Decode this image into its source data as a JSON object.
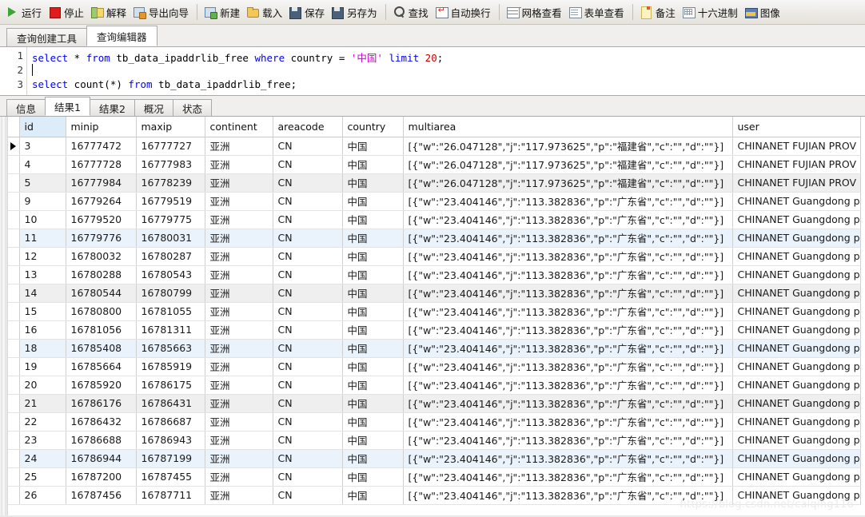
{
  "toolbar": {
    "groups": [
      {
        "items": [
          {
            "label": "运行",
            "icon": "run-icon",
            "icon_class": "ico-run"
          },
          {
            "label": "停止",
            "icon": "stop-icon",
            "icon_class": "ico-stop"
          },
          {
            "label": "解释",
            "icon": "explain-icon",
            "icon_class": "ico-explain"
          },
          {
            "label": "导出向导",
            "icon": "export-wizard-icon",
            "icon_class": "ico-export"
          }
        ]
      },
      {
        "items": [
          {
            "label": "新建",
            "icon": "new-icon",
            "icon_class": "ico-new"
          },
          {
            "label": "载入",
            "icon": "open-folder-icon",
            "icon_class": "ico-open"
          },
          {
            "label": "保存",
            "icon": "save-icon",
            "icon_class": "ico-save"
          },
          {
            "label": "另存为",
            "icon": "save-as-icon",
            "icon_class": "ico-saveas"
          }
        ]
      },
      {
        "items": [
          {
            "label": "查找",
            "icon": "search-icon",
            "icon_class": "ico-find"
          },
          {
            "label": "自动换行",
            "icon": "word-wrap-icon",
            "icon_class": "ico-wrap"
          }
        ]
      },
      {
        "items": [
          {
            "label": "网格查看",
            "icon": "grid-view-icon",
            "icon_class": "ico-grid"
          },
          {
            "label": "表单查看",
            "icon": "form-view-icon",
            "icon_class": "ico-form"
          }
        ]
      },
      {
        "items": [
          {
            "label": "备注",
            "icon": "note-icon",
            "icon_class": "ico-note"
          },
          {
            "label": "十六进制",
            "icon": "hex-icon",
            "icon_class": "ico-hex"
          },
          {
            "label": "图像",
            "icon": "image-icon",
            "icon_class": "ico-image"
          }
        ]
      }
    ]
  },
  "editor_tabs": [
    {
      "label": "查询创建工具",
      "active": false
    },
    {
      "label": "查询编辑器",
      "active": true
    }
  ],
  "editor": {
    "lines": [
      {
        "number": "1",
        "tokens": [
          {
            "text": "select",
            "type": "kw"
          },
          {
            "text": " * ",
            "type": "op"
          },
          {
            "text": "from",
            "type": "kw"
          },
          {
            "text": " tb_data_ipaddrlib_free ",
            "type": "op"
          },
          {
            "text": "where",
            "type": "kw"
          },
          {
            "text": " country = ",
            "type": "op"
          },
          {
            "text": "'中国'",
            "type": "str"
          },
          {
            "text": " ",
            "type": "op"
          },
          {
            "text": "limit",
            "type": "kw"
          },
          {
            "text": " ",
            "type": "op"
          },
          {
            "text": "20",
            "type": "num"
          },
          {
            "text": ";",
            "type": "op"
          }
        ]
      },
      {
        "number": "2",
        "tokens": []
      },
      {
        "number": "3",
        "tokens": [
          {
            "text": "select",
            "type": "kw"
          },
          {
            "text": " count(*) ",
            "type": "op"
          },
          {
            "text": "from",
            "type": "kw"
          },
          {
            "text": " tb_data_ipaddrlib_free;",
            "type": "op"
          }
        ]
      }
    ]
  },
  "result_tabs": [
    {
      "label": "信息",
      "active": false
    },
    {
      "label": "结果1",
      "active": true
    },
    {
      "label": "结果2",
      "active": false
    },
    {
      "label": "概况",
      "active": false
    },
    {
      "label": "状态",
      "active": false
    }
  ],
  "grid": {
    "columns": [
      {
        "key": "id",
        "label": "id",
        "selected": true,
        "align": "right"
      },
      {
        "key": "minip",
        "label": "minip",
        "selected": false,
        "align": "right"
      },
      {
        "key": "maxip",
        "label": "maxip",
        "selected": false,
        "align": "right"
      },
      {
        "key": "continent",
        "label": "continent",
        "selected": false,
        "align": "left"
      },
      {
        "key": "areacode",
        "label": "areacode",
        "selected": false,
        "align": "left"
      },
      {
        "key": "country",
        "label": "country",
        "selected": false,
        "align": "left"
      },
      {
        "key": "multiarea",
        "label": "multiarea",
        "selected": false,
        "align": "left"
      },
      {
        "key": "user",
        "label": "user",
        "selected": false,
        "align": "left"
      }
    ],
    "current_row_index": 0,
    "rows": [
      {
        "id": "3",
        "minip": "16777472",
        "maxip": "16777727",
        "continent": "亚洲",
        "areacode": "CN",
        "country": "中国",
        "multiarea": "[{\"w\":\"26.047128\",\"j\":\"117.973625\",\"p\":\"福建省\",\"c\":\"\",\"d\":\"\"}]",
        "user": "CHINANET FUJIAN PROV",
        "stripe": "none"
      },
      {
        "id": "4",
        "minip": "16777728",
        "maxip": "16777983",
        "continent": "亚洲",
        "areacode": "CN",
        "country": "中国",
        "multiarea": "[{\"w\":\"26.047128\",\"j\":\"117.973625\",\"p\":\"福建省\",\"c\":\"\",\"d\":\"\"}]",
        "user": "CHINANET FUJIAN PROV",
        "stripe": "none"
      },
      {
        "id": "5",
        "minip": "16777984",
        "maxip": "16778239",
        "continent": "亚洲",
        "areacode": "CN",
        "country": "中国",
        "multiarea": "[{\"w\":\"26.047128\",\"j\":\"117.973625\",\"p\":\"福建省\",\"c\":\"\",\"d\":\"\"}]",
        "user": "CHINANET FUJIAN PROV",
        "stripe": "gray"
      },
      {
        "id": "9",
        "minip": "16779264",
        "maxip": "16779519",
        "continent": "亚洲",
        "areacode": "CN",
        "country": "中国",
        "multiarea": "[{\"w\":\"23.404146\",\"j\":\"113.382836\",\"p\":\"广东省\",\"c\":\"\",\"d\":\"\"}]",
        "user": "CHINANET Guangdong p",
        "stripe": "none"
      },
      {
        "id": "10",
        "minip": "16779520",
        "maxip": "16779775",
        "continent": "亚洲",
        "areacode": "CN",
        "country": "中国",
        "multiarea": "[{\"w\":\"23.404146\",\"j\":\"113.382836\",\"p\":\"广东省\",\"c\":\"\",\"d\":\"\"}]",
        "user": "CHINANET Guangdong p",
        "stripe": "none"
      },
      {
        "id": "11",
        "minip": "16779776",
        "maxip": "16780031",
        "continent": "亚洲",
        "areacode": "CN",
        "country": "中国",
        "multiarea": "[{\"w\":\"23.404146\",\"j\":\"113.382836\",\"p\":\"广东省\",\"c\":\"\",\"d\":\"\"}]",
        "user": "CHINANET Guangdong p",
        "stripe": "blue"
      },
      {
        "id": "12",
        "minip": "16780032",
        "maxip": "16780287",
        "continent": "亚洲",
        "areacode": "CN",
        "country": "中国",
        "multiarea": "[{\"w\":\"23.404146\",\"j\":\"113.382836\",\"p\":\"广东省\",\"c\":\"\",\"d\":\"\"}]",
        "user": "CHINANET Guangdong p",
        "stripe": "none"
      },
      {
        "id": "13",
        "minip": "16780288",
        "maxip": "16780543",
        "continent": "亚洲",
        "areacode": "CN",
        "country": "中国",
        "multiarea": "[{\"w\":\"23.404146\",\"j\":\"113.382836\",\"p\":\"广东省\",\"c\":\"\",\"d\":\"\"}]",
        "user": "CHINANET Guangdong p",
        "stripe": "none"
      },
      {
        "id": "14",
        "minip": "16780544",
        "maxip": "16780799",
        "continent": "亚洲",
        "areacode": "CN",
        "country": "中国",
        "multiarea": "[{\"w\":\"23.404146\",\"j\":\"113.382836\",\"p\":\"广东省\",\"c\":\"\",\"d\":\"\"}]",
        "user": "CHINANET Guangdong p",
        "stripe": "gray"
      },
      {
        "id": "15",
        "minip": "16780800",
        "maxip": "16781055",
        "continent": "亚洲",
        "areacode": "CN",
        "country": "中国",
        "multiarea": "[{\"w\":\"23.404146\",\"j\":\"113.382836\",\"p\":\"广东省\",\"c\":\"\",\"d\":\"\"}]",
        "user": "CHINANET Guangdong p",
        "stripe": "none"
      },
      {
        "id": "16",
        "minip": "16781056",
        "maxip": "16781311",
        "continent": "亚洲",
        "areacode": "CN",
        "country": "中国",
        "multiarea": "[{\"w\":\"23.404146\",\"j\":\"113.382836\",\"p\":\"广东省\",\"c\":\"\",\"d\":\"\"}]",
        "user": "CHINANET Guangdong p",
        "stripe": "none"
      },
      {
        "id": "18",
        "minip": "16785408",
        "maxip": "16785663",
        "continent": "亚洲",
        "areacode": "CN",
        "country": "中国",
        "multiarea": "[{\"w\":\"23.404146\",\"j\":\"113.382836\",\"p\":\"广东省\",\"c\":\"\",\"d\":\"\"}]",
        "user": "CHINANET Guangdong p",
        "stripe": "blue"
      },
      {
        "id": "19",
        "minip": "16785664",
        "maxip": "16785919",
        "continent": "亚洲",
        "areacode": "CN",
        "country": "中国",
        "multiarea": "[{\"w\":\"23.404146\",\"j\":\"113.382836\",\"p\":\"广东省\",\"c\":\"\",\"d\":\"\"}]",
        "user": "CHINANET Guangdong p",
        "stripe": "none"
      },
      {
        "id": "20",
        "minip": "16785920",
        "maxip": "16786175",
        "continent": "亚洲",
        "areacode": "CN",
        "country": "中国",
        "multiarea": "[{\"w\":\"23.404146\",\"j\":\"113.382836\",\"p\":\"广东省\",\"c\":\"\",\"d\":\"\"}]",
        "user": "CHINANET Guangdong p",
        "stripe": "none"
      },
      {
        "id": "21",
        "minip": "16786176",
        "maxip": "16786431",
        "continent": "亚洲",
        "areacode": "CN",
        "country": "中国",
        "multiarea": "[{\"w\":\"23.404146\",\"j\":\"113.382836\",\"p\":\"广东省\",\"c\":\"\",\"d\":\"\"}]",
        "user": "CHINANET Guangdong p",
        "stripe": "gray"
      },
      {
        "id": "22",
        "minip": "16786432",
        "maxip": "16786687",
        "continent": "亚洲",
        "areacode": "CN",
        "country": "中国",
        "multiarea": "[{\"w\":\"23.404146\",\"j\":\"113.382836\",\"p\":\"广东省\",\"c\":\"\",\"d\":\"\"}]",
        "user": "CHINANET Guangdong p",
        "stripe": "none"
      },
      {
        "id": "23",
        "minip": "16786688",
        "maxip": "16786943",
        "continent": "亚洲",
        "areacode": "CN",
        "country": "中国",
        "multiarea": "[{\"w\":\"23.404146\",\"j\":\"113.382836\",\"p\":\"广东省\",\"c\":\"\",\"d\":\"\"}]",
        "user": "CHINANET Guangdong p",
        "stripe": "none"
      },
      {
        "id": "24",
        "minip": "16786944",
        "maxip": "16787199",
        "continent": "亚洲",
        "areacode": "CN",
        "country": "中国",
        "multiarea": "[{\"w\":\"23.404146\",\"j\":\"113.382836\",\"p\":\"广东省\",\"c\":\"\",\"d\":\"\"}]",
        "user": "CHINANET Guangdong p",
        "stripe": "blue"
      },
      {
        "id": "25",
        "minip": "16787200",
        "maxip": "16787455",
        "continent": "亚洲",
        "areacode": "CN",
        "country": "中国",
        "multiarea": "[{\"w\":\"23.404146\",\"j\":\"113.382836\",\"p\":\"广东省\",\"c\":\"\",\"d\":\"\"}]",
        "user": "CHINANET Guangdong p",
        "stripe": "none"
      },
      {
        "id": "26",
        "minip": "16787456",
        "maxip": "16787711",
        "continent": "亚洲",
        "areacode": "CN",
        "country": "中国",
        "multiarea": "[{\"w\":\"23.404146\",\"j\":\"113.382836\",\"p\":\"广东省\",\"c\":\"\",\"d\":\"\"}]",
        "user": "CHINANET Guangdong p",
        "stripe": "none"
      }
    ]
  },
  "watermark": "https://blog.csdn.net/caiqing116",
  "colors": {
    "keyword": "#0000ff",
    "string": "#cc00cc",
    "number": "#cc0000",
    "selected_header": "#ddecf9",
    "stripe_gray": "#efefef",
    "stripe_blue": "#eaf2fb"
  }
}
